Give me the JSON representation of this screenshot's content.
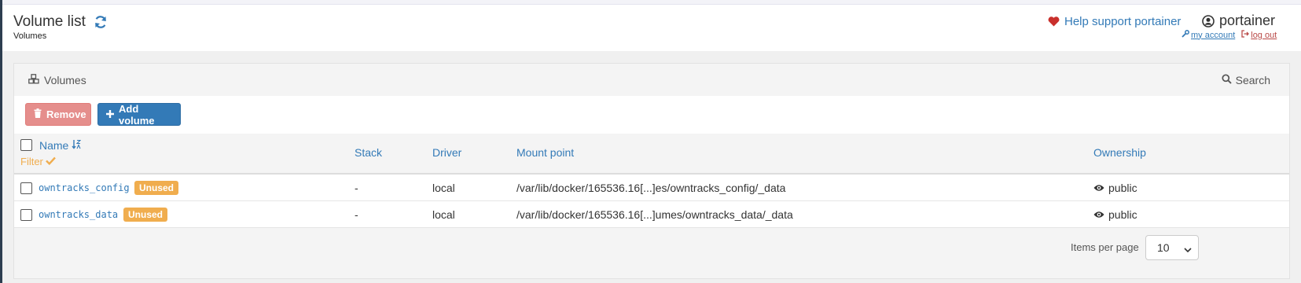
{
  "header": {
    "title": "Volume list",
    "breadcrumb": "Volumes",
    "help_label": "Help support portainer",
    "username": "portainer",
    "my_account": "my account",
    "log_out": "log out"
  },
  "widget": {
    "title": "Volumes",
    "search_label": "Search"
  },
  "actions": {
    "remove_label": "Remove",
    "add_label": "Add volume"
  },
  "table": {
    "columns": {
      "name": "Name",
      "filter": "Filter",
      "stack": "Stack",
      "driver": "Driver",
      "mount_point": "Mount point",
      "ownership": "Ownership"
    },
    "rows": [
      {
        "name": "owntracks_config",
        "badge": "Unused",
        "stack": "-",
        "driver": "local",
        "mount_point": "/var/lib/docker/165536.16[...]es/owntracks_config/_data",
        "ownership": "public"
      },
      {
        "name": "owntracks_data",
        "badge": "Unused",
        "stack": "-",
        "driver": "local",
        "mount_point": "/var/lib/docker/165536.16[...]umes/owntracks_data/_data",
        "ownership": "public"
      }
    ]
  },
  "footer": {
    "items_per_page_label": "Items per page",
    "items_per_page_value": "10"
  },
  "colors": {
    "primary": "#337ab7",
    "danger_light": "#e58e8c",
    "warning": "#f0ad4e",
    "heart": "#c9302c",
    "sidebar": "#2d3e50"
  }
}
